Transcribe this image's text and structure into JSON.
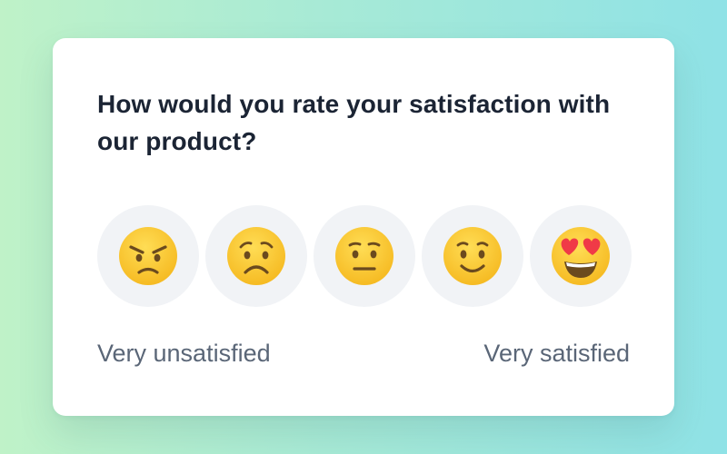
{
  "survey": {
    "question": "How would you rate your satisfaction with our product?",
    "options": [
      {
        "icon": "angry-face-icon",
        "rating": 1
      },
      {
        "icon": "frowning-face-icon",
        "rating": 2
      },
      {
        "icon": "neutral-face-icon",
        "rating": 3
      },
      {
        "icon": "slightly-smiling-face-icon",
        "rating": 4
      },
      {
        "icon": "heart-eyes-face-icon",
        "rating": 5
      }
    ],
    "min_label": "Very unsatisfied",
    "max_label": "Very satisfied"
  },
  "colors": {
    "face_yellow": "#ffcc3d",
    "feature_brown": "#6b4a1e",
    "heart_red": "#f03a47",
    "button_bg": "#f1f3f6",
    "question_text": "#1b2434",
    "label_text": "#5a6677"
  }
}
